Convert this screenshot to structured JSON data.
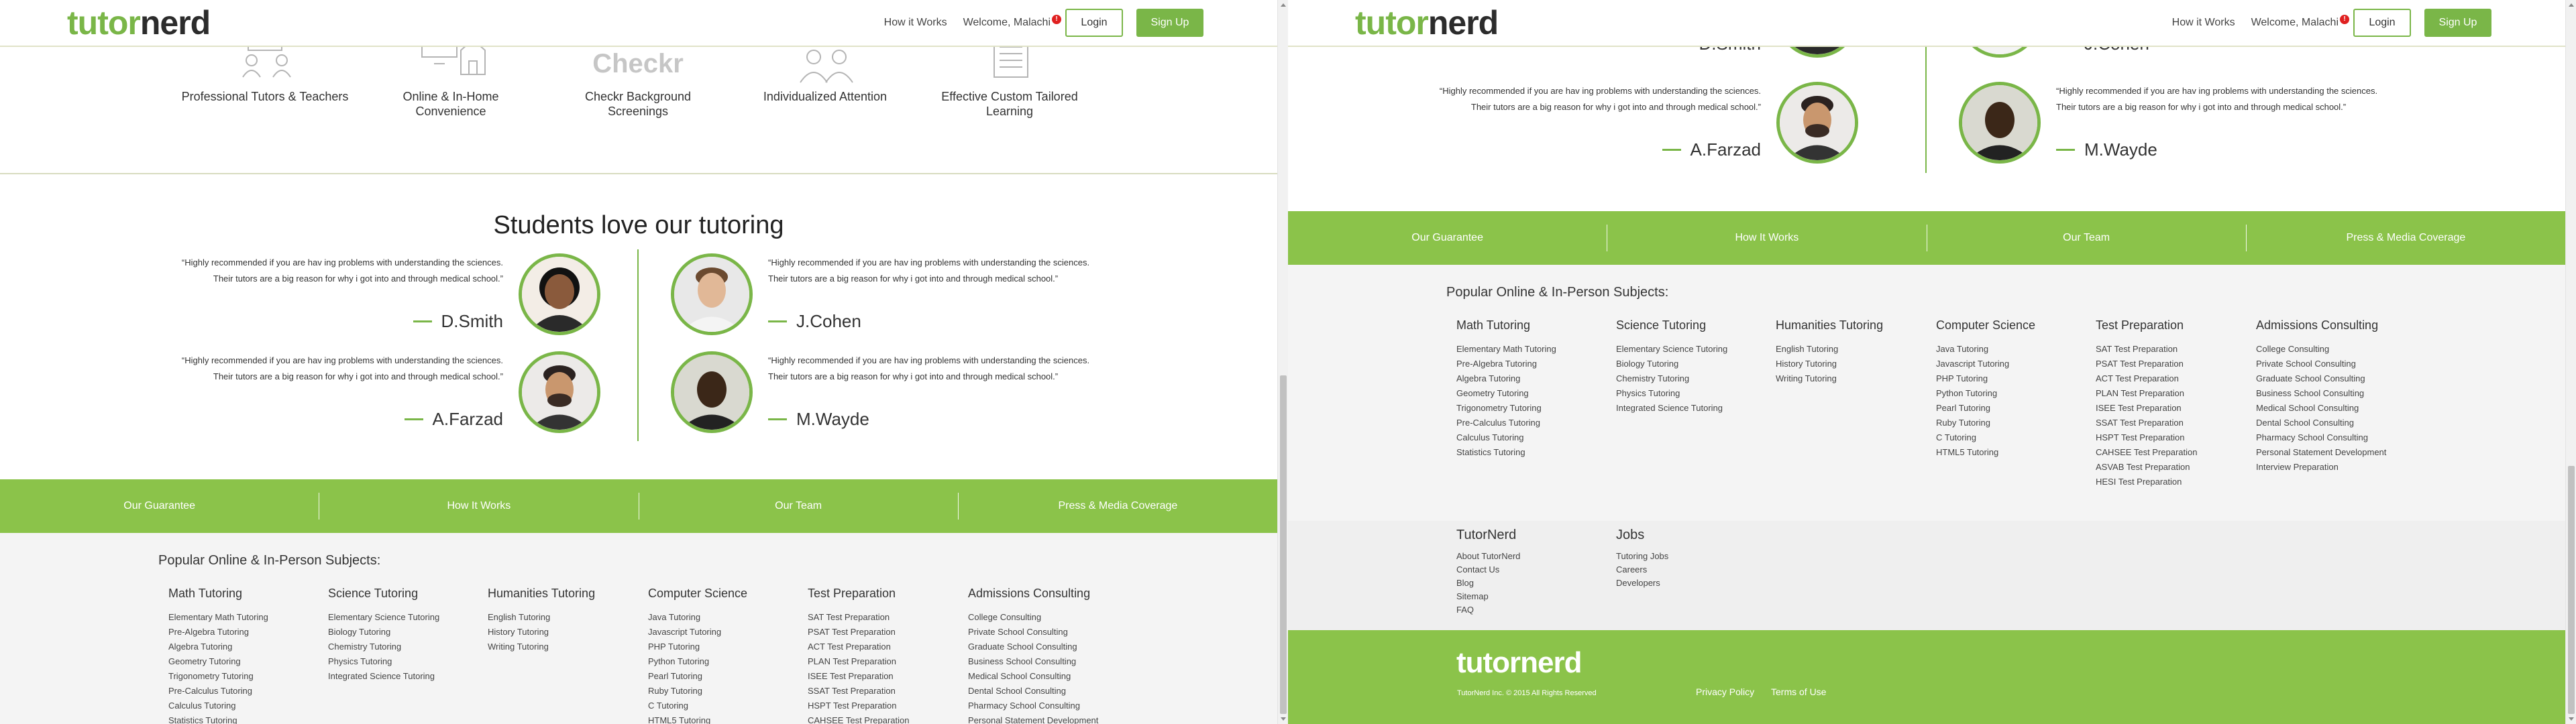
{
  "header": {
    "logo_part1": "tutor",
    "logo_part2": "nerd",
    "how_it_works": "How it Works",
    "welcome": "Welcome, Malachi",
    "alert_badge": "!",
    "login": "Login",
    "signup": "Sign Up"
  },
  "features": [
    {
      "label": "Professional Tutors & Teachers",
      "icon": "tutors-icon"
    },
    {
      "label": "Online & In-Home Convenience",
      "icon": "computer-home-icon"
    },
    {
      "label": "Checkr Background Screenings",
      "icon": "checkr-logo"
    },
    {
      "label": "Individualized Attention",
      "icon": "people-icon"
    },
    {
      "label": "Effective Custom Tailored Learning",
      "icon": "book-icon"
    }
  ],
  "checkr_text": "Checkr",
  "testimonials": {
    "title": "Students love our tutoring",
    "quote": "“Highly recommended if you are hav ing problems with understanding the sciences. Their tutors are a big reason for why i got into and through medical school.”",
    "people": [
      {
        "name": "D.Smith"
      },
      {
        "name": "J.Cohen"
      },
      {
        "name": "A.Farzad"
      },
      {
        "name": "M.Wayde"
      }
    ]
  },
  "green_nav": [
    "Our Guarantee",
    "How It Works",
    "Our Team",
    "Press & Media Coverage"
  ],
  "subjects": {
    "title": "Popular Online & In-Person Subjects:",
    "columns": [
      {
        "heading": "Math Tutoring",
        "items": [
          "Elementary Math Tutoring",
          "Pre-Algebra Tutoring",
          "Algebra Tutoring",
          "Geometry Tutoring",
          "Trigonometry Tutoring",
          "Pre-Calculus Tutoring",
          "Calculus Tutoring",
          "Statistics Tutoring"
        ]
      },
      {
        "heading": "Science Tutoring",
        "items": [
          "Elementary Science Tutoring",
          "Biology Tutoring",
          "Chemistry Tutoring",
          "Physics Tutoring",
          "Integrated Science Tutoring"
        ]
      },
      {
        "heading": "Humanities Tutoring",
        "items": [
          "English Tutoring",
          "History Tutoring",
          "Writing Tutoring"
        ]
      },
      {
        "heading": "Computer Science",
        "items": [
          "Java Tutoring",
          "Javascript Tutoring",
          "PHP Tutoring",
          "Python Tutoring",
          "Pearl Tutoring",
          "Ruby Tutoring",
          "C Tutoring",
          "HTML5 Tutoring"
        ]
      },
      {
        "heading": "Test Preparation",
        "items": [
          "SAT Test Preparation",
          "PSAT Test Preparation",
          "ACT Test Preparation",
          "PLAN Test Preparation",
          "ISEE Test Preparation",
          "SSAT Test Preparation",
          "HSPT Test Preparation",
          "CAHSEE Test Preparation",
          "ASVAB Test Preparation",
          "HESI Test Preparation"
        ]
      },
      {
        "heading": "Admissions Consulting",
        "items": [
          "College Consulting",
          "Private School Consulting",
          "Graduate School Consulting",
          "Business School Consulting",
          "Medical School Consulting",
          "Dental School Consulting",
          "Pharmacy School Consulting",
          "Personal Statement Development",
          "Interview Preparation"
        ]
      }
    ]
  },
  "footer_links": {
    "tutornerd": {
      "heading": "TutorNerd",
      "items": [
        "About TutorNerd",
        "Contact Us",
        "Blog",
        "Sitemap",
        "FAQ"
      ]
    },
    "jobs": {
      "heading": "Jobs",
      "items": [
        "Tutoring Jobs",
        "Careers",
        "Developers"
      ]
    }
  },
  "green_footer": {
    "logo": "tutornerd",
    "copyright": "TutorNerd Inc. © 2015 All Rights Reserved",
    "privacy": "Privacy Policy",
    "terms": "Terms of Use"
  },
  "colors": {
    "brand_green": "#8bc34a",
    "logo_green": "#7ab648"
  }
}
